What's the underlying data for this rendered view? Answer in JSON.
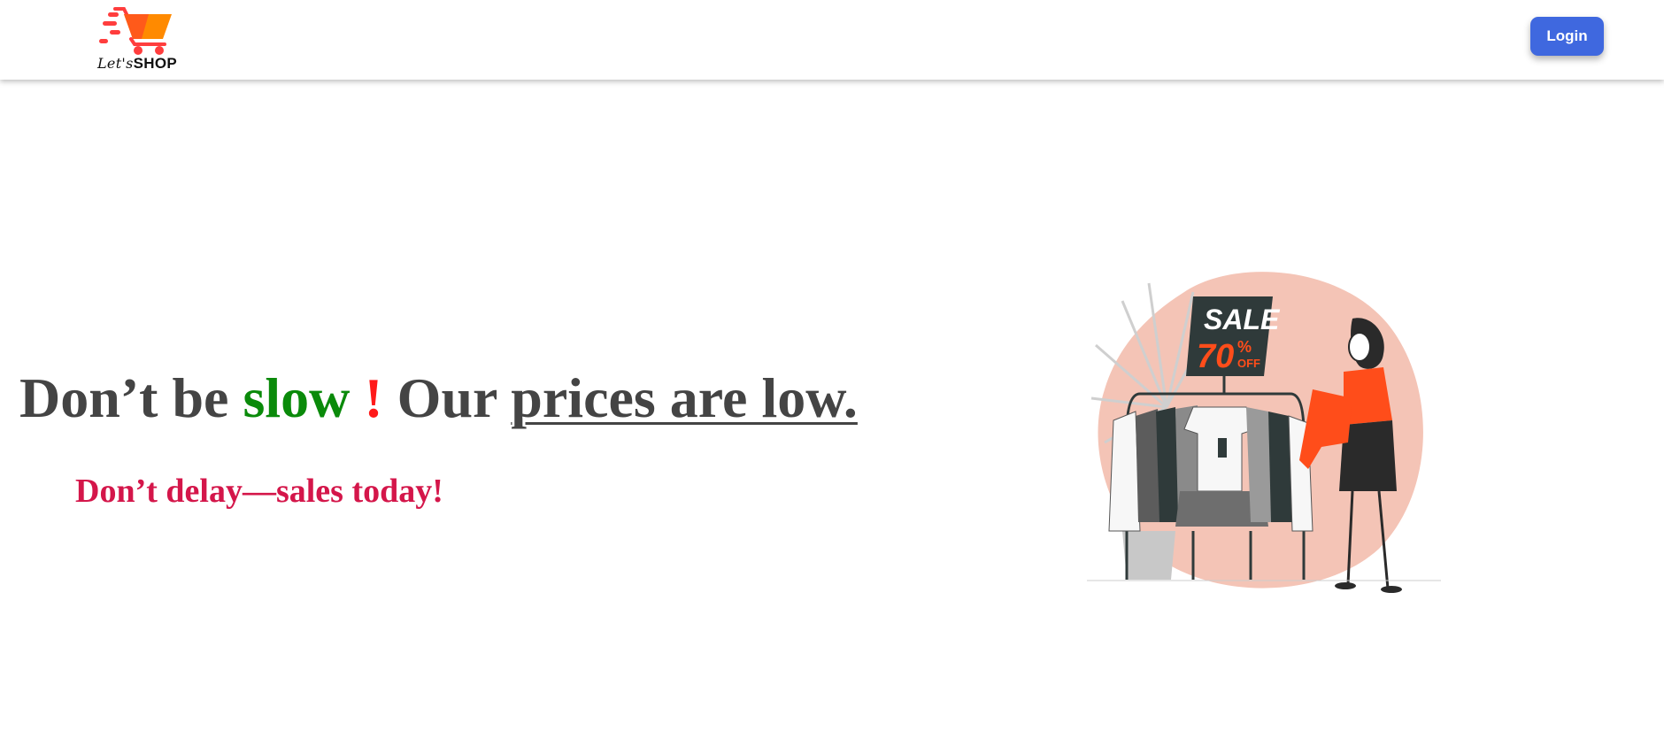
{
  "header": {
    "logo": {
      "text_script": "Let's",
      "text_bold": "SHOP",
      "icon": "shopping-cart-icon",
      "colors": [
        "#ff3d3d",
        "#ff8a00"
      ]
    },
    "login_label": "Login",
    "login_color": "#3f68df"
  },
  "hero": {
    "headline": {
      "part1": "Don’t be ",
      "part2": "slow",
      "part3": " ! ",
      "part4": "Our ",
      "part5": "prices are low.",
      "colors": {
        "text": "#444444",
        "accent_green": "#0a8a0a",
        "accent_red": "#ff1a1a"
      }
    },
    "subheadline": "Don’t delay—sales today!",
    "subheadline_color": "#d4164a",
    "illustration": {
      "sign_line1": "SALE",
      "sign_line2": "70",
      "sign_line3": "%",
      "sign_line4": "OFF",
      "tag_label": "SALE"
    }
  }
}
